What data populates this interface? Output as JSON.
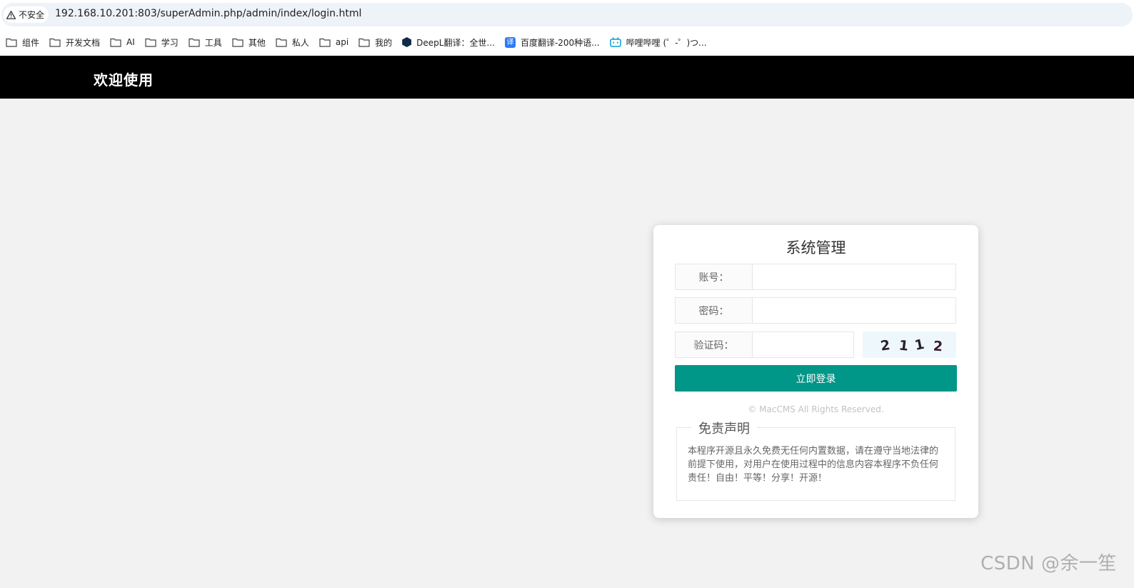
{
  "browser": {
    "security_label": "不安全",
    "url": "192.168.10.201:803/superAdmin.php/admin/index/login.html"
  },
  "bookmarks": [
    {
      "label": "组件",
      "icon": "folder-icon"
    },
    {
      "label": "开发文档",
      "icon": "folder-icon"
    },
    {
      "label": "AI",
      "icon": "folder-icon"
    },
    {
      "label": "学习",
      "icon": "folder-icon"
    },
    {
      "label": "工具",
      "icon": "folder-icon"
    },
    {
      "label": "其他",
      "icon": "folder-icon"
    },
    {
      "label": "私人",
      "icon": "folder-icon"
    },
    {
      "label": "api",
      "icon": "folder-icon"
    },
    {
      "label": "我的",
      "icon": "folder-icon"
    },
    {
      "label": "DeepL翻译：全世...",
      "icon": "deepl-icon"
    },
    {
      "label": "百度翻译-200种语...",
      "icon": "baidu-translate-icon"
    },
    {
      "label": "哔哩哔哩 (゜-゜)つ...",
      "icon": "bilibili-icon"
    }
  ],
  "header": {
    "title": "欢迎使用"
  },
  "login": {
    "title": "系统管理",
    "account_label": "账号：",
    "account_value": "",
    "password_label": "密码：",
    "password_value": "",
    "captcha_label": "验证码：",
    "captcha_value": "",
    "captcha_text": "2112",
    "submit_label": "立即登录",
    "copyright": "© MacCMS All Rights Reserved.",
    "disclaimer_title": "免责声明",
    "disclaimer_text": "本程序开源且永久免费无任何内置数据，请在遵守当地法律的前提下使用，对用户在使用过程中的信息内容本程序不负任何责任！自由！平等！分享！开源！"
  },
  "colors": {
    "header_bg": "#000000",
    "button_bg": "#009688",
    "page_bg": "#f2f2f2"
  },
  "watermark": "CSDN @余一笙"
}
